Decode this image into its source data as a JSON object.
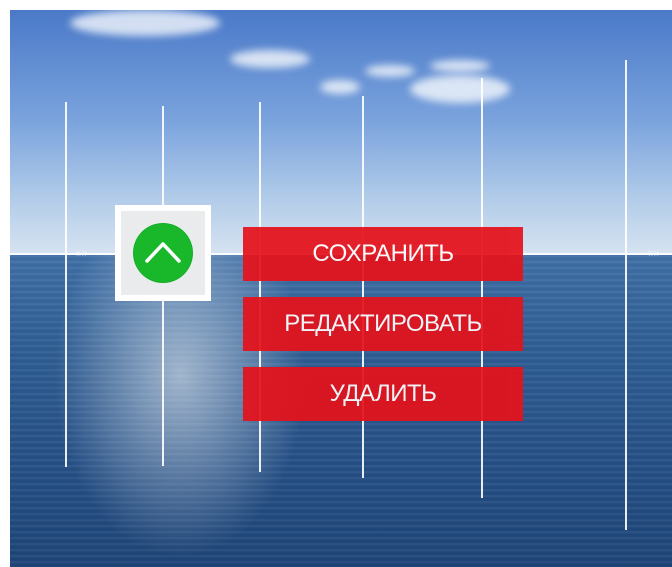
{
  "background": {
    "sky_color": "#4a79c8",
    "sea_color": "#244e84",
    "line_color": "#ffffff"
  },
  "scroll_toggle": {
    "icon": "chevron-up-icon",
    "color": "#18b82a"
  },
  "actions": {
    "save_label": "СОХРАНИТЬ",
    "edit_label": "РЕДАКТИРОВАТЬ",
    "delete_label": "УДАЛИТЬ",
    "color": "#e5121b"
  }
}
